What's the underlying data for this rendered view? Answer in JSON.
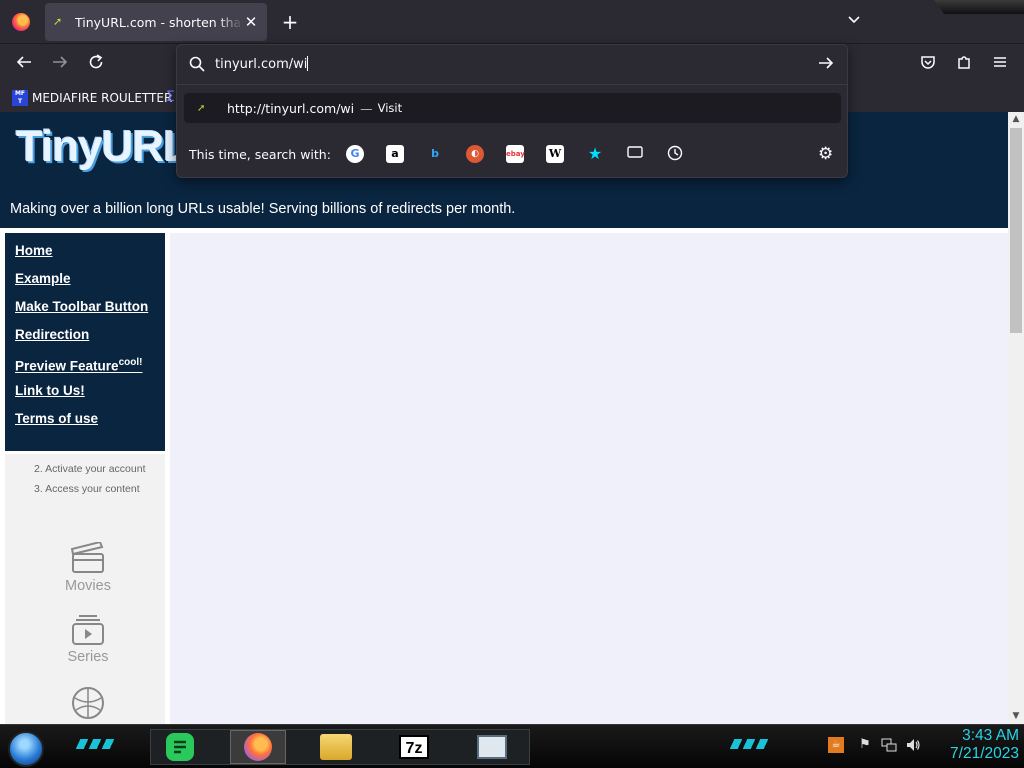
{
  "browser": {
    "tab": {
      "title": "TinyURL.com - shorten that long URL into a tiny URL",
      "close": "✕"
    },
    "new_tab": "+",
    "url_input": {
      "value": "tinyurl.com/wi"
    },
    "bookmarks": [
      {
        "label": "MEDIAFIRE ROULETTER",
        "icon_text": "MF\nT"
      }
    ],
    "dropdown": {
      "suggestion": {
        "url": "http://tinyurl.com/wi",
        "separator": "—",
        "action": "Visit"
      },
      "oneoff_label": "This time, search with:",
      "engines": [
        {
          "name": "google",
          "glyph": "G",
          "color": "#4285f4",
          "bg": "#ffffff"
        },
        {
          "name": "amazon",
          "glyph": "a",
          "color": "#000000",
          "bg": "#ffffff"
        },
        {
          "name": "bing",
          "glyph": "b",
          "color": "#2fa8f5",
          "bg": "transparent"
        },
        {
          "name": "duckduckgo",
          "glyph": "◐",
          "color": "#ffffff",
          "bg": "#de5833"
        },
        {
          "name": "ebay",
          "glyph": "ebay",
          "color": "#e53238",
          "bg": "#ffffff"
        },
        {
          "name": "wikipedia",
          "glyph": "W",
          "color": "#000000",
          "bg": "#ffffff"
        },
        {
          "name": "bookmarks",
          "glyph": "★",
          "color": "#00ddff",
          "bg": "transparent"
        },
        {
          "name": "tabs",
          "glyph": "▭",
          "color": "#fbfbfe",
          "bg": "transparent"
        },
        {
          "name": "history",
          "glyph": "◷",
          "color": "#fbfbfe",
          "bg": "transparent"
        }
      ]
    }
  },
  "page": {
    "logo": "TinyURL",
    "tagline": "Making over a billion long URLs usable! Serving billions of redirects per month.",
    "nav": [
      {
        "label": "Home"
      },
      {
        "label": "Example"
      },
      {
        "label": "Make Toolbar Button"
      },
      {
        "label": "Redirection"
      },
      {
        "label": "Preview Feature",
        "sup": "cool!"
      },
      {
        "label": "Link to Us!"
      },
      {
        "label": "Terms of use"
      }
    ],
    "ad": {
      "steps": [
        "2. Activate your account",
        "3. Access your content"
      ],
      "categories": [
        "Movies",
        "Series"
      ]
    }
  },
  "taskbar": {
    "time": "3:43 AM",
    "date": "7/21/2023",
    "accent_color": "#27d4e6"
  }
}
